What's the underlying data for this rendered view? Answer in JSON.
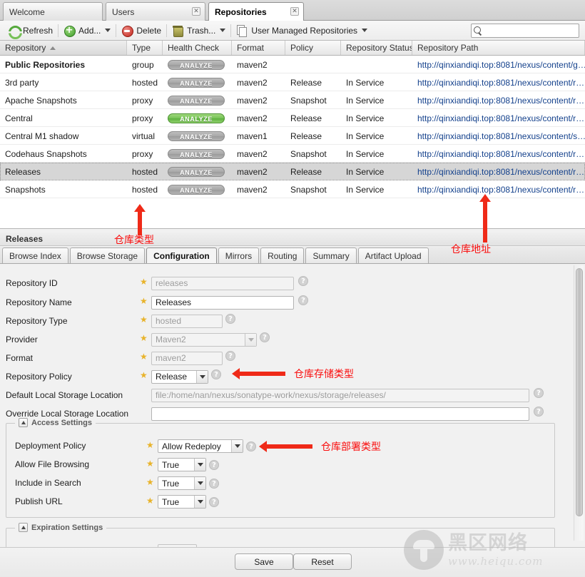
{
  "tabs": [
    {
      "label": "Welcome",
      "closable": false,
      "active": false
    },
    {
      "label": "Users",
      "closable": true,
      "active": false
    },
    {
      "label": "Repositories",
      "closable": true,
      "active": true
    }
  ],
  "toolbar": {
    "refresh_label": "Refresh",
    "add_label": "Add...",
    "delete_label": "Delete",
    "trash_label": "Trash...",
    "managed_label": "User Managed Repositories",
    "search_value": "",
    "search_placeholder": ""
  },
  "grid": {
    "columns": [
      "Repository",
      "Type",
      "Health Check",
      "Format",
      "Policy",
      "Repository Status",
      "Repository Path"
    ],
    "sorted_column": "Repository",
    "sort_direction": "asc",
    "analyze_label": "ANALYZE",
    "rows": [
      {
        "repository": "Public Repositories",
        "type": "group",
        "health": "grey",
        "format": "maven2",
        "policy": "",
        "status": "",
        "path": "http://qinxiandiqi.top:8081/nexus/content/g…",
        "bold": true,
        "selected": false
      },
      {
        "repository": "3rd party",
        "type": "hosted",
        "health": "grey",
        "format": "maven2",
        "policy": "Release",
        "status": "In Service",
        "path": "http://qinxiandiqi.top:8081/nexus/content/r…",
        "bold": false,
        "selected": false
      },
      {
        "repository": "Apache Snapshots",
        "type": "proxy",
        "health": "grey",
        "format": "maven2",
        "policy": "Snapshot",
        "status": "In Service",
        "path": "http://qinxiandiqi.top:8081/nexus/content/r…",
        "bold": false,
        "selected": false
      },
      {
        "repository": "Central",
        "type": "proxy",
        "health": "green",
        "format": "maven2",
        "policy": "Release",
        "status": "In Service",
        "path": "http://qinxiandiqi.top:8081/nexus/content/r…",
        "bold": false,
        "selected": false
      },
      {
        "repository": "Central M1 shadow",
        "type": "virtual",
        "health": "grey",
        "format": "maven1",
        "policy": "Release",
        "status": "In Service",
        "path": "http://qinxiandiqi.top:8081/nexus/content/s…",
        "bold": false,
        "selected": false
      },
      {
        "repository": "Codehaus Snapshots",
        "type": "proxy",
        "health": "grey",
        "format": "maven2",
        "policy": "Snapshot",
        "status": "In Service",
        "path": "http://qinxiandiqi.top:8081/nexus/content/r…",
        "bold": false,
        "selected": false
      },
      {
        "repository": "Releases",
        "type": "hosted",
        "health": "grey",
        "format": "maven2",
        "policy": "Release",
        "status": "In Service",
        "path": "http://qinxiandiqi.top:8081/nexus/content/r…",
        "bold": false,
        "selected": true
      },
      {
        "repository": "Snapshots",
        "type": "hosted",
        "health": "grey",
        "format": "maven2",
        "policy": "Snapshot",
        "status": "In Service",
        "path": "http://qinxiandiqi.top:8081/nexus/content/r…",
        "bold": false,
        "selected": false
      }
    ]
  },
  "detail": {
    "title": "Releases",
    "subtabs": [
      {
        "label": "Browse Index",
        "active": false
      },
      {
        "label": "Browse Storage",
        "active": false
      },
      {
        "label": "Configuration",
        "active": true
      },
      {
        "label": "Mirrors",
        "active": false
      },
      {
        "label": "Routing",
        "active": false
      },
      {
        "label": "Summary",
        "active": false
      },
      {
        "label": "Artifact Upload",
        "active": false
      }
    ],
    "fields": {
      "repository_id": {
        "label": "Repository ID",
        "value": "releases",
        "disabled": true
      },
      "repository_name": {
        "label": "Repository Name",
        "value": "Releases",
        "disabled": false
      },
      "repository_type": {
        "label": "Repository Type",
        "value": "hosted",
        "disabled": true
      },
      "provider": {
        "label": "Provider",
        "value": "Maven2",
        "disabled": true
      },
      "format": {
        "label": "Format",
        "value": "maven2",
        "disabled": true
      },
      "repository_policy": {
        "label": "Repository Policy",
        "value": "Release",
        "disabled": false
      },
      "default_storage": {
        "label": "Default Local Storage Location",
        "value": "file:/home/nan/nexus/sonatype-work/nexus/storage/releases/",
        "disabled": true
      },
      "override_storage": {
        "label": "Override Local Storage Location",
        "value": "",
        "disabled": false
      }
    },
    "access_settings": {
      "legend": "Access Settings",
      "rows": [
        {
          "label": "Deployment Policy",
          "value": "Allow Redeploy",
          "wide": true
        },
        {
          "label": "Allow File Browsing",
          "value": "True",
          "wide": false
        },
        {
          "label": "Include in Search",
          "value": "True",
          "wide": false
        },
        {
          "label": "Publish URL",
          "value": "True",
          "wide": false
        }
      ]
    },
    "expiration_settings": {
      "legend": "Expiration Settings"
    }
  },
  "footer": {
    "save_label": "Save",
    "reset_label": "Reset"
  },
  "annotations": [
    {
      "key": "repo_type",
      "text": "仓库类型"
    },
    {
      "key": "repo_path",
      "text": "仓库地址"
    },
    {
      "key": "repo_storage",
      "text": "仓库存储类型"
    },
    {
      "key": "repo_deployment",
      "text": "仓库部署类型"
    }
  ],
  "watermark": {
    "cn": "黑区网络",
    "url": "www.heiqu.com"
  },
  "colors": {
    "accent_green": "#76c256",
    "link": "#14418c",
    "annotation_red": "#fa0d0d",
    "star_gold": "#e8b32a"
  }
}
